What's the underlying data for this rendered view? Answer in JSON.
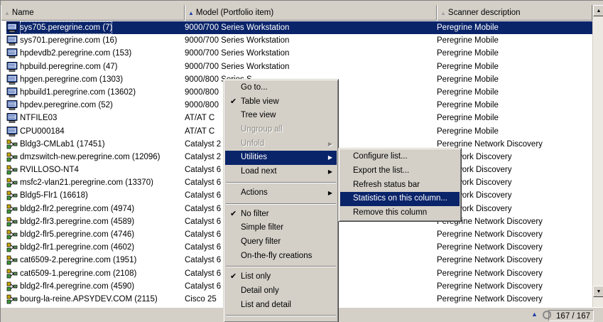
{
  "columns": [
    {
      "label": "Name",
      "sort_glyph": "▲",
      "active": false
    },
    {
      "label": "Model (Portfolio item)",
      "sort_glyph": "▲",
      "active": true
    },
    {
      "label": "Scanner description",
      "sort_glyph": "▲",
      "active": false
    }
  ],
  "rows": [
    {
      "name": "sys705.peregrine.com (7)",
      "model": "9000/700 Series Workstation",
      "scanner": "Peregrine Mobile",
      "icon": "workstation-icon",
      "selected": true
    },
    {
      "name": "sys701.peregrine.com (16)",
      "model": "9000/700 Series Workstation",
      "scanner": "Peregrine Mobile",
      "icon": "workstation-icon"
    },
    {
      "name": "hpdevdb2.peregrine.com (153)",
      "model": "9000/700 Series Workstation",
      "scanner": "Peregrine Mobile",
      "icon": "workstation-icon"
    },
    {
      "name": "hpbuild.peregrine.com (47)",
      "model": "9000/700 Series Workstation",
      "scanner": "Peregrine Mobile",
      "icon": "workstation-icon"
    },
    {
      "name": "hpgen.peregrine.com (1303)",
      "model": "9000/800 Series S",
      "scanner": "Peregrine Mobile",
      "icon": "workstation-icon"
    },
    {
      "name": "hpbuild1.peregrine.com (13602)",
      "model": "9000/800",
      "scanner": "Peregrine Mobile",
      "icon": "workstation-icon"
    },
    {
      "name": "hpdev.peregrine.com (52)",
      "model": "9000/800",
      "scanner": "Peregrine Mobile",
      "icon": "workstation-icon"
    },
    {
      "name": "NTFILE03",
      "model": "AT/AT C",
      "scanner": "Peregrine Mobile",
      "icon": "workstation-icon"
    },
    {
      "name": "CPU000184",
      "model": "AT/AT C",
      "scanner": "Peregrine Mobile",
      "icon": "workstation-icon"
    },
    {
      "name": "Bldg3-CMLab1 (17451)",
      "model": "Catalyst 2",
      "scanner": "Peregrine Network Discovery",
      "icon": "network-device-icon"
    },
    {
      "name": "dmzswitch-new.peregrine.com (12096)",
      "model": "Catalyst 2",
      "scanner": "e Network Discovery",
      "icon": "network-device-icon"
    },
    {
      "name": "RVILLOSO-NT4",
      "model": "Catalyst 6",
      "scanner": "e Network Discovery",
      "icon": "network-device-icon"
    },
    {
      "name": "msfc2-vlan21.peregrine.com (13370)",
      "model": "Catalyst 6",
      "scanner": "e Network Discovery",
      "icon": "network-device-icon"
    },
    {
      "name": "Bldg5-Flr1 (16618)",
      "model": "Catalyst 6",
      "scanner": "e Network Discovery",
      "icon": "network-device-icon"
    },
    {
      "name": "bldg2-flr2.peregrine.com (4974)",
      "model": "Catalyst 6",
      "scanner": "e Network Discovery",
      "icon": "network-device-icon"
    },
    {
      "name": "bldg2-flr3.peregrine.com (4589)",
      "model": "Catalyst 6",
      "scanner": "Peregrine Network Discovery",
      "icon": "network-device-icon"
    },
    {
      "name": "bldg2-flr5.peregrine.com (4746)",
      "model": "Catalyst 6",
      "scanner": "Peregrine Network Discovery",
      "icon": "network-device-icon"
    },
    {
      "name": "bldg2-flr1.peregrine.com (4602)",
      "model": "Catalyst 6",
      "scanner": "Peregrine Network Discovery",
      "icon": "network-device-icon"
    },
    {
      "name": "cat6509-2.peregrine.com (1951)",
      "model": "Catalyst 6",
      "scanner": "Peregrine Network Discovery",
      "icon": "network-device-icon"
    },
    {
      "name": "cat6509-1.peregrine.com (2108)",
      "model": "Catalyst 6",
      "scanner": "Peregrine Network Discovery",
      "icon": "network-device-icon"
    },
    {
      "name": "bldg2-flr4.peregrine.com (4590)",
      "model": "Catalyst 6",
      "scanner": "Peregrine Network Discovery",
      "icon": "network-device-icon"
    },
    {
      "name": "bourg-la-reine.APSYDEV.COM (2115)",
      "model": "Cisco 25",
      "scanner": "Peregrine Network Discovery",
      "icon": "network-device-icon"
    }
  ],
  "context_menu": {
    "items": [
      {
        "label": "Go to...",
        "type": "item"
      },
      {
        "label": "Table view",
        "type": "item",
        "checked": true
      },
      {
        "label": "Tree view",
        "type": "item"
      },
      {
        "label": "Ungroup all",
        "type": "item",
        "disabled": true
      },
      {
        "label": "Unfold",
        "type": "item",
        "disabled": true,
        "submenu": true
      },
      {
        "label": "Utilities",
        "type": "item",
        "submenu": true,
        "highlight": true
      },
      {
        "label": "Load next",
        "type": "item",
        "submenu": true
      },
      {
        "type": "separator"
      },
      {
        "label": "Actions",
        "type": "item",
        "submenu": true
      },
      {
        "type": "separator"
      },
      {
        "label": "No filter",
        "type": "item",
        "checked": true
      },
      {
        "label": "Simple filter",
        "type": "item"
      },
      {
        "label": "Query filter",
        "type": "item"
      },
      {
        "label": "On-the-fly creations",
        "type": "item"
      },
      {
        "type": "separator"
      },
      {
        "label": "List only",
        "type": "item",
        "checked": true
      },
      {
        "label": "Detail only",
        "type": "item"
      },
      {
        "label": "List and detail",
        "type": "item"
      },
      {
        "type": "separator"
      }
    ],
    "check_glyph": "✔",
    "arrow_glyph": "▶"
  },
  "utilities_submenu": {
    "items": [
      {
        "label": "Configure list..."
      },
      {
        "label": "Export the list..."
      },
      {
        "label": "Refresh status bar"
      },
      {
        "label": "Statistics on this column...",
        "highlight": true
      },
      {
        "label": "Remove this column"
      }
    ]
  },
  "status": {
    "count": "167 / 167"
  },
  "colors": {
    "selection": "#0a246a",
    "chrome": "#d4d0c8"
  }
}
